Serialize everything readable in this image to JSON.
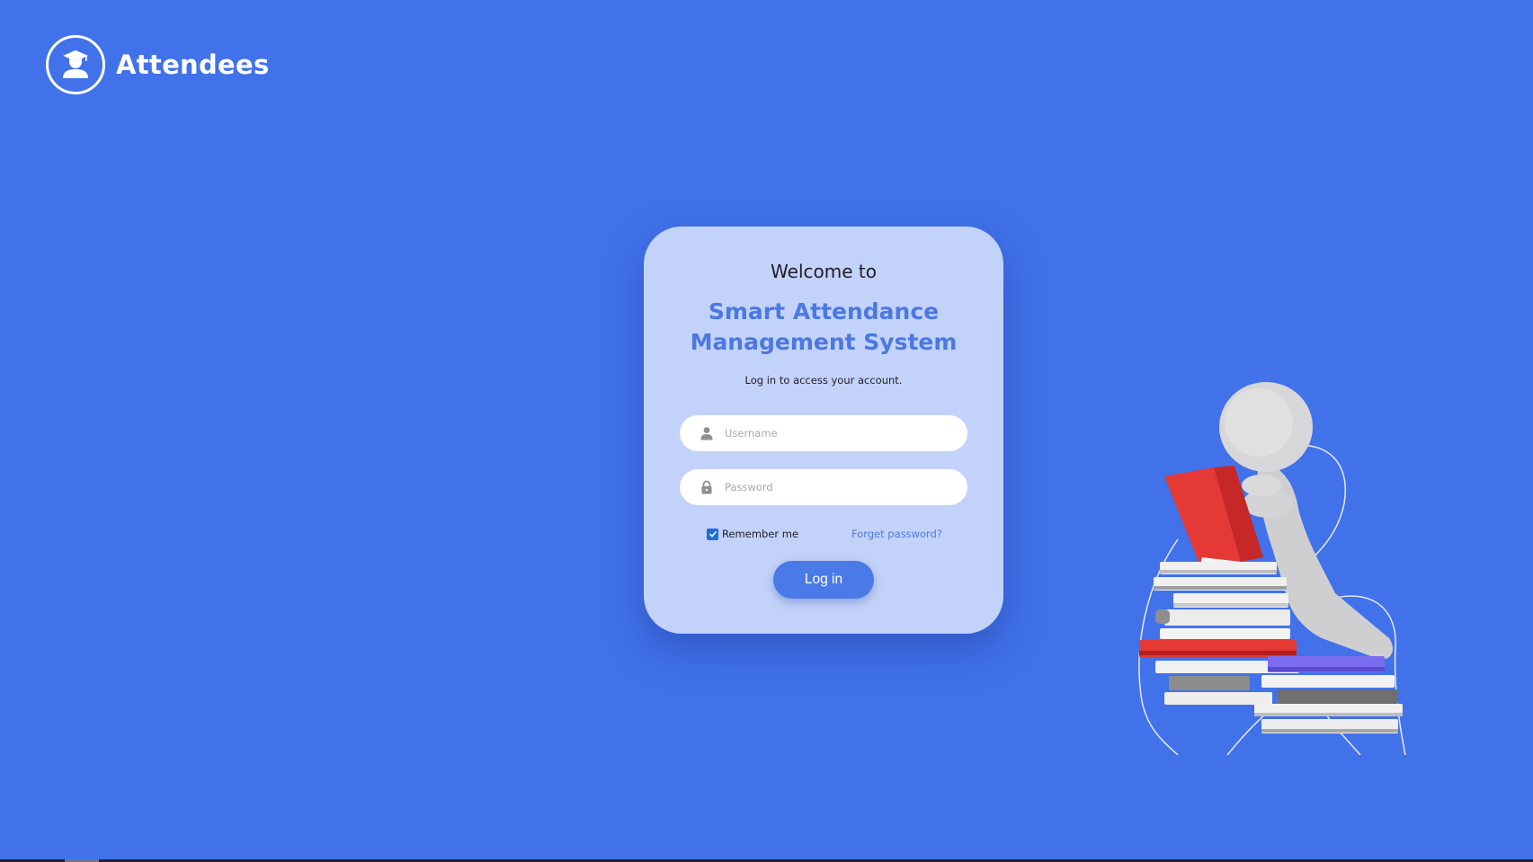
{
  "brand": {
    "name": "Attendees",
    "logo_icon": "graduate-icon"
  },
  "login_card": {
    "welcome": "Welcome to",
    "system_title": "Smart Attendance Management System",
    "subtitle": "Log in to access your account.",
    "username": {
      "placeholder": "Username",
      "value": "",
      "icon": "user-icon"
    },
    "password": {
      "placeholder": "Password",
      "value": "",
      "icon": "lock-icon"
    },
    "remember_me": {
      "label": "Remember me",
      "checked": true
    },
    "forget_password": "Forget password?",
    "login_button": "Log in"
  },
  "illustration": {
    "icon": "person-reading-books-illustration"
  },
  "colors": {
    "background": "#4172ea",
    "card": "#c3d2f8",
    "accent": "#4b78e3",
    "button": "#4a79e8",
    "checkbox": "#1a6fd8"
  }
}
